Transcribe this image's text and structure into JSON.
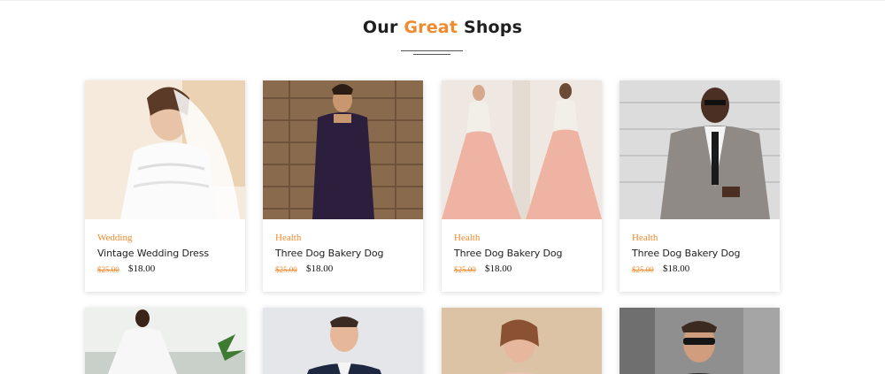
{
  "section": {
    "title_pre": "Our",
    "title_accent": "Great",
    "title_post": "Shops"
  },
  "colors": {
    "accent": "#f08a2c",
    "text": "#222222"
  },
  "products": [
    {
      "category": "Wedding",
      "name": "Vintage Wedding Dress",
      "old_price": "$25.00",
      "price": "$18.00"
    },
    {
      "category": "Health",
      "name": "Three Dog Bakery Dog",
      "old_price": "$25.00",
      "price": "$18.00"
    },
    {
      "category": "Health",
      "name": "Three Dog Bakery Dog",
      "old_price": "$25.00",
      "price": "$18.00"
    },
    {
      "category": "Health",
      "name": "Three Dog Bakery Dog",
      "old_price": "$25.00",
      "price": "$18.00"
    }
  ]
}
